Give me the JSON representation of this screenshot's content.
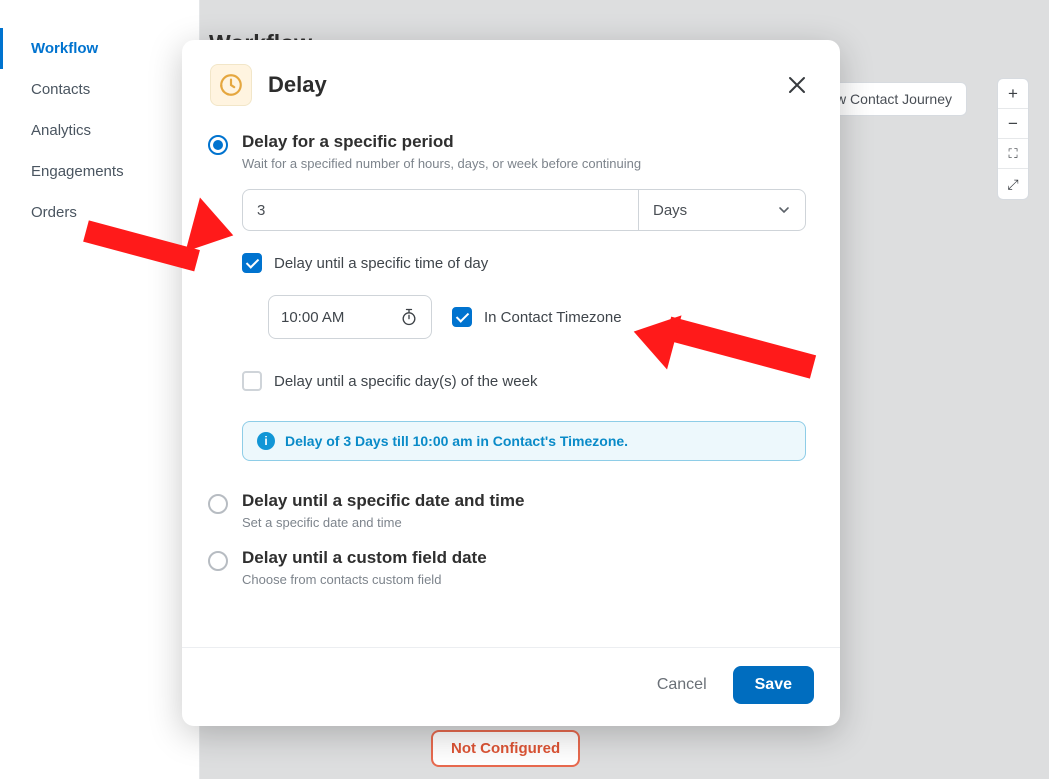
{
  "sidebar": {
    "items": [
      {
        "label": "Workflow",
        "active": true
      },
      {
        "label": "Contacts",
        "active": false
      },
      {
        "label": "Analytics",
        "active": false
      },
      {
        "label": "Engagements",
        "active": false
      },
      {
        "label": "Orders",
        "active": false
      }
    ]
  },
  "background": {
    "title": "Workflow",
    "view_journey_label": "View Contact Journey",
    "not_configured_label": "Not Configured"
  },
  "zoom": {
    "in": "+",
    "out": "−",
    "fit": "⛶",
    "full": "⤢"
  },
  "modal": {
    "title": "Delay",
    "option_period": {
      "title": "Delay for a specific period",
      "subtitle": "Wait for a specified number of hours, days, or week before continuing"
    },
    "option_datetime": {
      "title": "Delay until a specific date and time",
      "subtitle": "Set a specific date and time"
    },
    "option_custom": {
      "title": "Delay until a custom field date",
      "subtitle": "Choose from contacts custom field"
    },
    "qty_value": "3",
    "unit_label": "Days",
    "check_time_of_day_label": "Delay until a specific time of day",
    "time_value": "10:00  AM",
    "in_contact_tz_label": "In Contact Timezone",
    "check_dow_label": "Delay until a specific day(s) of the week",
    "summary_text": "Delay of 3 Days till 10:00 am in Contact's Timezone.",
    "cancel_label": "Cancel",
    "save_label": "Save"
  }
}
